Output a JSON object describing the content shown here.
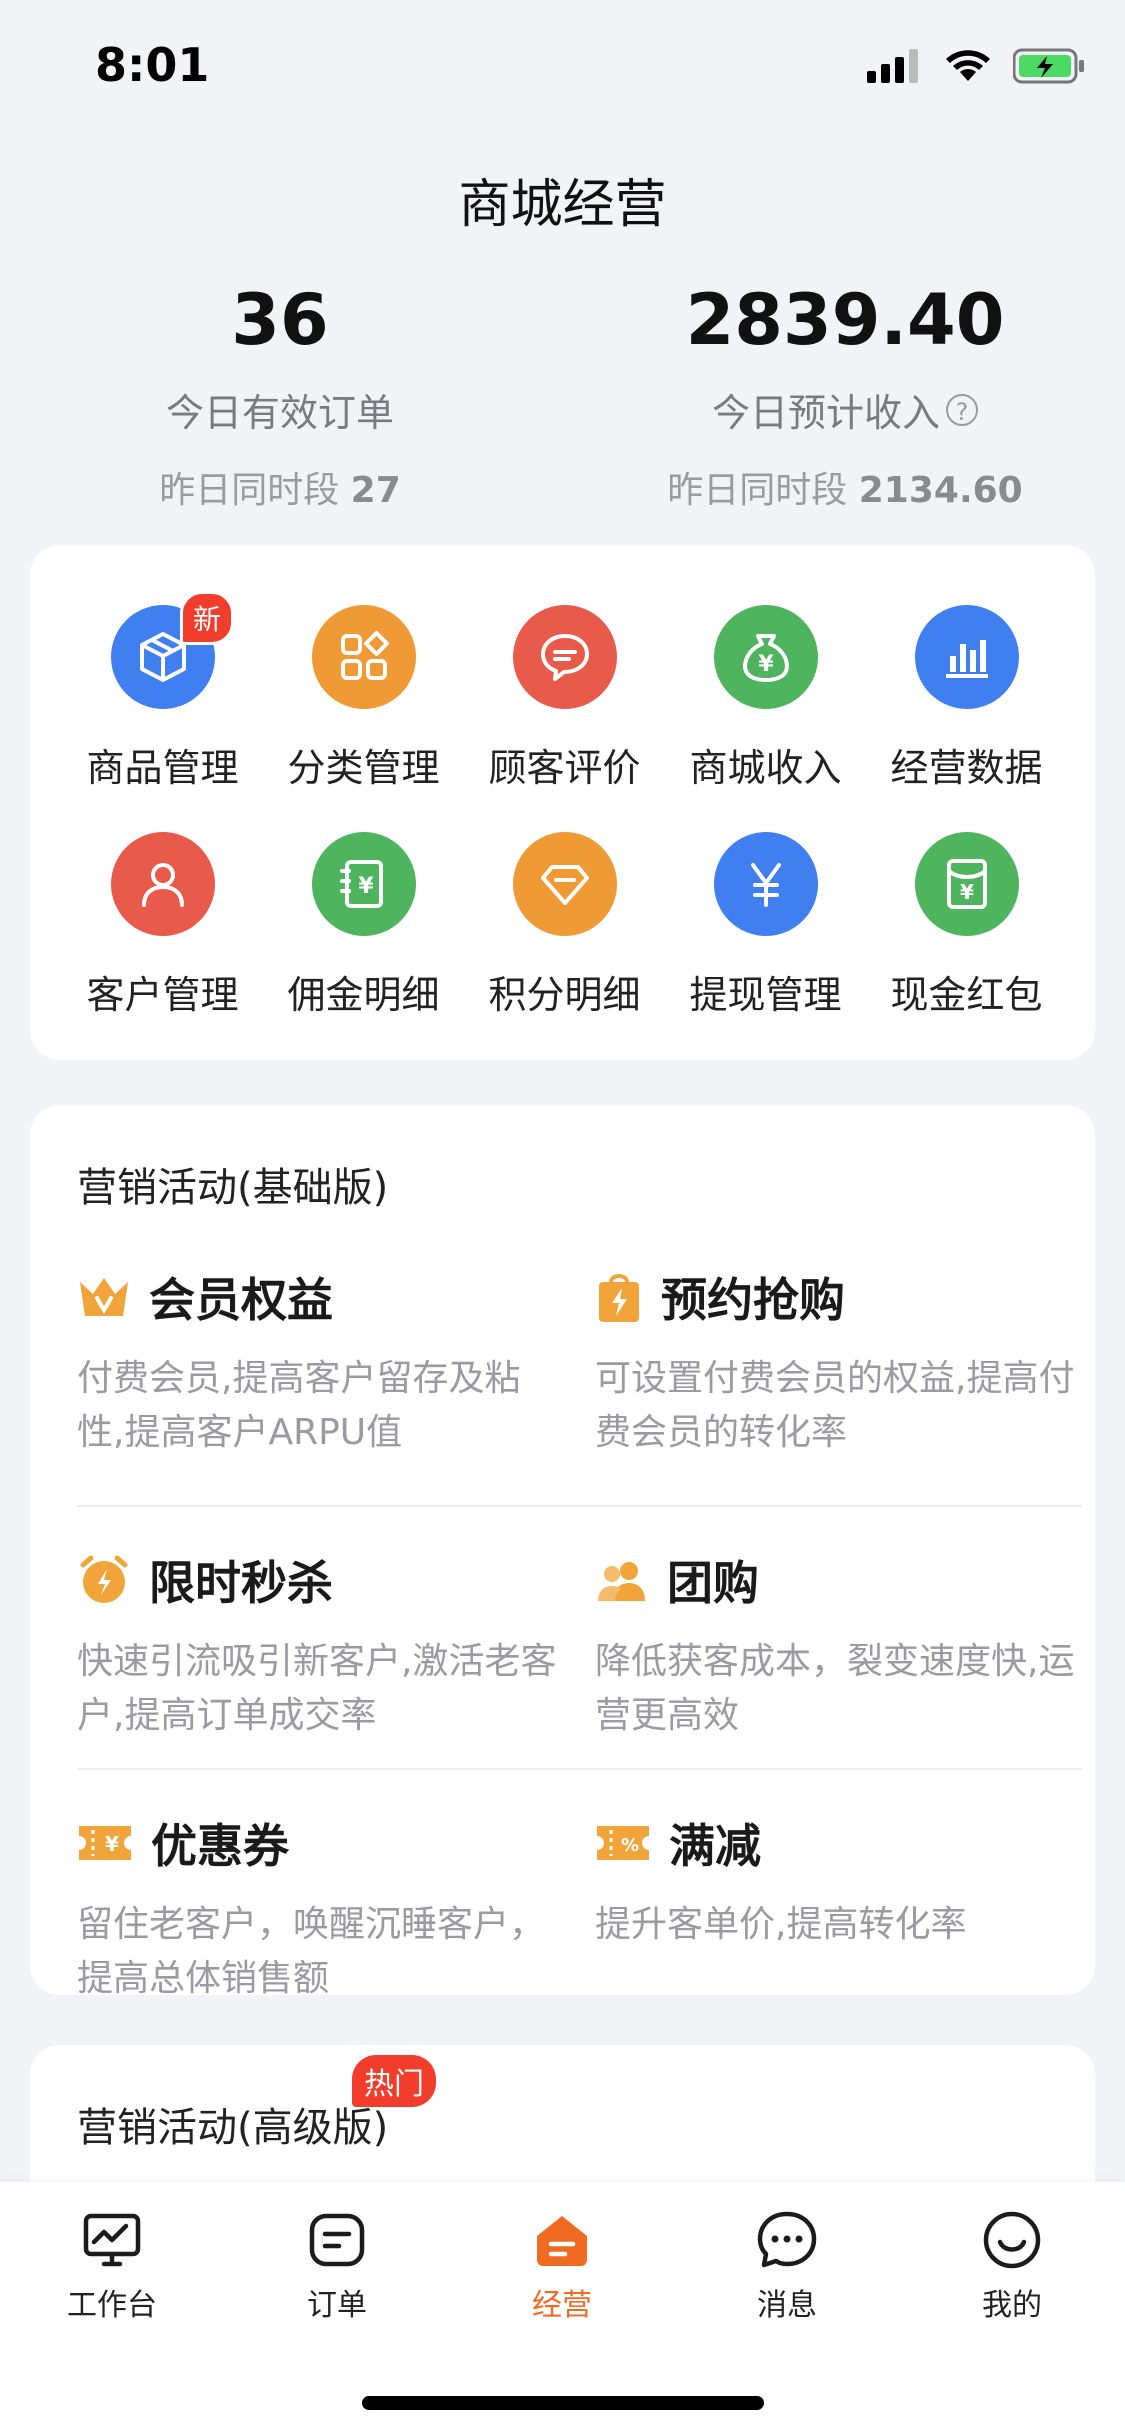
{
  "status_bar": {
    "time": "8:01"
  },
  "page_title": "商城经营",
  "stats": {
    "orders": {
      "value": "36",
      "label": "今日有效订单",
      "prev_label": "昨日同时段",
      "prev_value": "27"
    },
    "revenue": {
      "value": "2839.40",
      "label": "今日预计收入",
      "help": "?",
      "prev_label": "昨日同时段",
      "prev_value": "2134.60"
    }
  },
  "grid": {
    "badge_new": "新",
    "items": [
      {
        "label": "商品管理",
        "icon": "box-icon",
        "color": "#3f7ff0"
      },
      {
        "label": "分类管理",
        "icon": "category-icon",
        "color": "#ef9a34"
      },
      {
        "label": "顾客评价",
        "icon": "comment-icon",
        "color": "#e85a4a"
      },
      {
        "label": "商城收入",
        "icon": "money-bag-icon",
        "color": "#4fb45e"
      },
      {
        "label": "经营数据",
        "icon": "bar-chart-icon",
        "color": "#3f7ff0"
      },
      {
        "label": "客户管理",
        "icon": "user-icon",
        "color": "#e85a4a"
      },
      {
        "label": "佣金明细",
        "icon": "ledger-icon",
        "color": "#4fb45e"
      },
      {
        "label": "积分明细",
        "icon": "diamond-icon",
        "color": "#ef9a34"
      },
      {
        "label": "提现管理",
        "icon": "yen-icon",
        "color": "#3f7ff0"
      },
      {
        "label": "现金红包",
        "icon": "red-packet-icon",
        "color": "#4fb45e"
      }
    ]
  },
  "marketing_basic": {
    "title": "营销活动(基础版)",
    "items": [
      {
        "name": "会员权益",
        "icon": "crown-icon",
        "desc": "付费会员,提高客户留存及粘性,提高客户ARPU值"
      },
      {
        "name": "预约抢购",
        "icon": "lightning-bag-icon",
        "desc": "可设置付费会员的权益,提高付费会员的转化率"
      },
      {
        "name": "限时秒杀",
        "icon": "alarm-icon",
        "desc": "快速引流吸引新客户,激活老客户,提高订单成交率"
      },
      {
        "name": "团购",
        "icon": "group-icon",
        "desc": "降低获客成本，裂变速度快,运营更高效"
      },
      {
        "name": "优惠券",
        "icon": "coupon-icon",
        "desc": "留住老客户，唤醒沉睡客户，提高总体销售额"
      },
      {
        "name": "满减",
        "icon": "discount-icon",
        "desc": "提升客单价,提高转化率"
      }
    ]
  },
  "marketing_advanced": {
    "title": "营销活动(高级版)",
    "badge": "热门"
  },
  "tabbar": {
    "items": [
      {
        "label": "工作台",
        "icon": "workbench-icon"
      },
      {
        "label": "订单",
        "icon": "order-icon"
      },
      {
        "label": "经营",
        "icon": "store-icon",
        "active": true
      },
      {
        "label": "消息",
        "icon": "message-icon"
      },
      {
        "label": "我的",
        "icon": "profile-icon"
      }
    ],
    "active_color": "#f06a22"
  }
}
